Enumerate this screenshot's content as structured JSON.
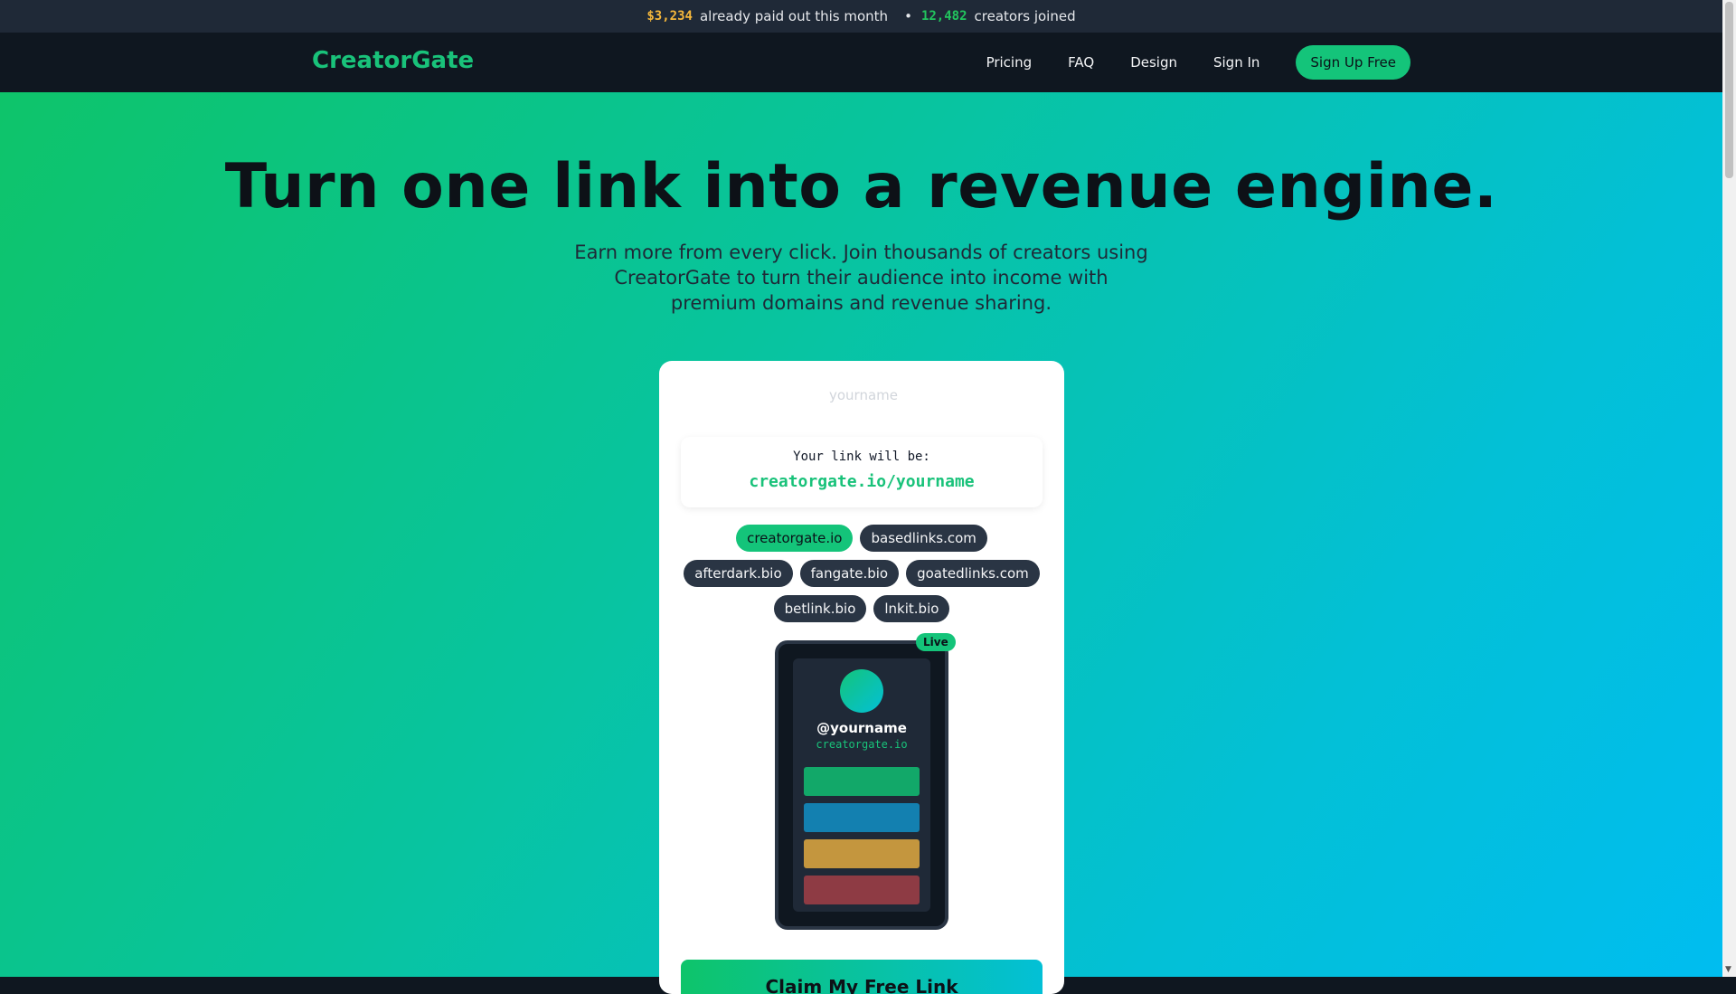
{
  "topbar": {
    "paid_amount": "$3,234",
    "paid_text": "already paid out this month",
    "separator": "•",
    "creators_count": "12,482",
    "creators_text": "creators joined"
  },
  "nav": {
    "logo": "CreatorGate",
    "links": [
      "Pricing",
      "FAQ",
      "Design",
      "Sign In"
    ],
    "signup": "Sign Up Free"
  },
  "hero": {
    "title": "Turn one link into a revenue engine.",
    "subtitle": "Earn more from every click. Join thousands of creators using CreatorGate to turn their audience into income with premium domains and revenue sharing."
  },
  "form": {
    "username_placeholder": "yourname",
    "username_value": "",
    "preview_label": "Your link will be:",
    "preview_url": "creatorgate.io/yourname",
    "domains": [
      "creatorgate.io",
      "basedlinks.com",
      "afterdark.bio",
      "fangate.bio",
      "goatedlinks.com",
      "betlink.bio",
      "lnkit.bio"
    ],
    "selected_domain": "creatorgate.io",
    "claim_button": "Claim My Free Link"
  },
  "phone_preview": {
    "badge": "Live",
    "handle": "@yourname",
    "domain": "creatorgate.io",
    "button_colors": [
      "#12a869",
      "#1380b0",
      "#c4963e",
      "#8e3b44"
    ]
  },
  "colors": {
    "brand": "#19c27a",
    "accent_gold": "#f5b73b"
  }
}
